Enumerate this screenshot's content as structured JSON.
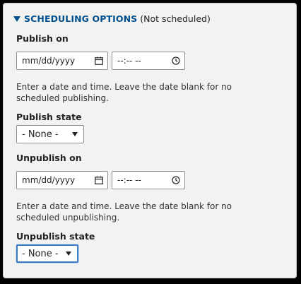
{
  "fieldset": {
    "title": "SCHEDULING OPTIONS",
    "status": "(Not scheduled)"
  },
  "publish": {
    "label": "Publish on",
    "date_placeholder": "mm/dd/yyyy",
    "time_placeholder": "--:-- --",
    "description": "Enter a date and time. Leave the date blank for no scheduled publishing."
  },
  "publish_state": {
    "label": "Publish state",
    "selected": "- None -"
  },
  "unpublish": {
    "label": "Unpublish on",
    "date_placeholder": "mm/dd/yyyy",
    "time_placeholder": "--:-- --",
    "description": "Enter a date and time. Leave the date blank for no scheduled unpublishing."
  },
  "unpublish_state": {
    "label": "Unpublish state",
    "selected": "- None -"
  },
  "colors": {
    "summary_link": "#004f8f",
    "panel_bg": "#f2f2f0",
    "focus_border": "#3d7cc9"
  },
  "icons": [
    "disclosure-triangle-icon",
    "calendar-icon",
    "clock-icon",
    "dropdown-caret-icon"
  ]
}
